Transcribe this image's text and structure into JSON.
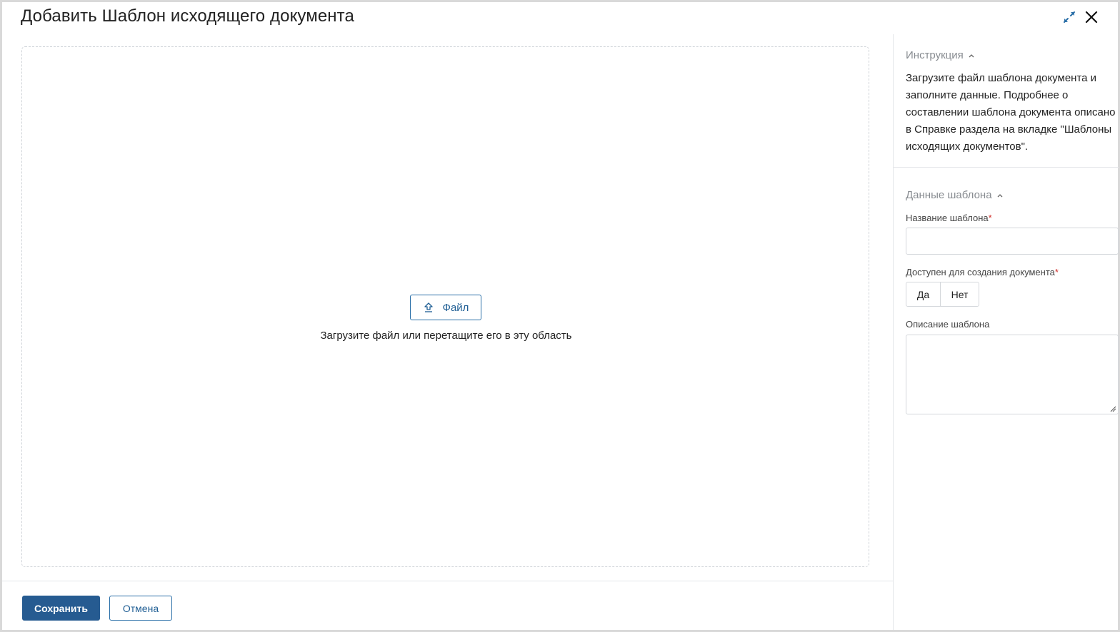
{
  "dialog": {
    "title": "Добавить Шаблон исходящего документа"
  },
  "upload": {
    "file_button_label": "Файл",
    "hint": "Загрузите файл или перетащите его в эту область"
  },
  "footer": {
    "save_label": "Сохранить",
    "cancel_label": "Отмена"
  },
  "sidebar": {
    "instruction": {
      "title": "Инструкция",
      "text": "Загрузите файл шаблона документа и заполните данные. Подробнее о составлении шаблона документа описано в Справке раздела на вкладке \"Шаблоны исходящих документов\"."
    },
    "template_data": {
      "title": "Данные шаблона",
      "name_label": "Название шаблона",
      "name_value": "",
      "available_label": "Доступен для создания документа",
      "option_yes": "Да",
      "option_no": "Нет",
      "description_label": "Описание шаблона",
      "description_value": "",
      "required_mark": "*"
    }
  },
  "colors": {
    "primary": "#265b91",
    "required": "#d0312d"
  }
}
